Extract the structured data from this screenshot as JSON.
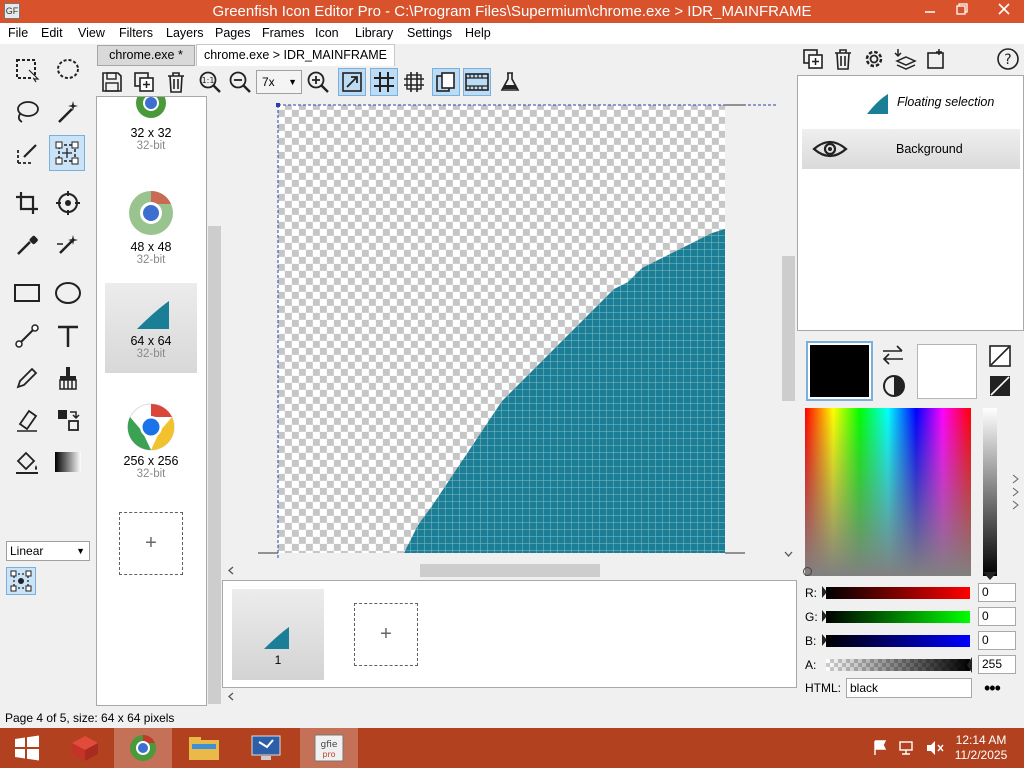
{
  "window": {
    "title": "Greenfish Icon Editor Pro - C:\\Program Files\\Supermium\\chrome.exe > IDR_MAINFRAME",
    "app_icon_text": "GF"
  },
  "menu": [
    "File",
    "Edit",
    "View",
    "Filters",
    "Layers",
    "Pages",
    "Frames",
    "Icon",
    "Library",
    "Settings",
    "Help"
  ],
  "tabs": [
    "chrome.exe *",
    "chrome.exe > IDR_MAINFRAME"
  ],
  "toolbox": {
    "gradient_mode": "Linear"
  },
  "canvas_toolbar": {
    "zoom": "7x"
  },
  "pages": [
    {
      "size": "32 x 32",
      "depth": "32-bit"
    },
    {
      "size": "48 x 48",
      "depth": "32-bit"
    },
    {
      "size": "64 x 64",
      "depth": "32-bit",
      "selected": true
    },
    {
      "size": "256 x 256",
      "depth": "32-bit"
    }
  ],
  "add_symbol": "+",
  "frames": [
    {
      "label": "1"
    }
  ],
  "layers": [
    {
      "name": "Floating selection"
    },
    {
      "name": "Background"
    }
  ],
  "colors": {
    "accent": "#1a7f96",
    "foreground": "#000000",
    "background": "#ffffff"
  },
  "sliders": [
    {
      "label": "R:",
      "value": "0"
    },
    {
      "label": "G:",
      "value": "0"
    },
    {
      "label": "B:",
      "value": "0"
    },
    {
      "label": "A:",
      "value": "255"
    }
  ],
  "html_color": {
    "label": "HTML:",
    "value": "black"
  },
  "more_label": "•••",
  "status": "Page 4 of 5, size: 64 x 64 pixels",
  "taskbar": {
    "time": "12:14 AM",
    "date": "11/2/2025"
  }
}
